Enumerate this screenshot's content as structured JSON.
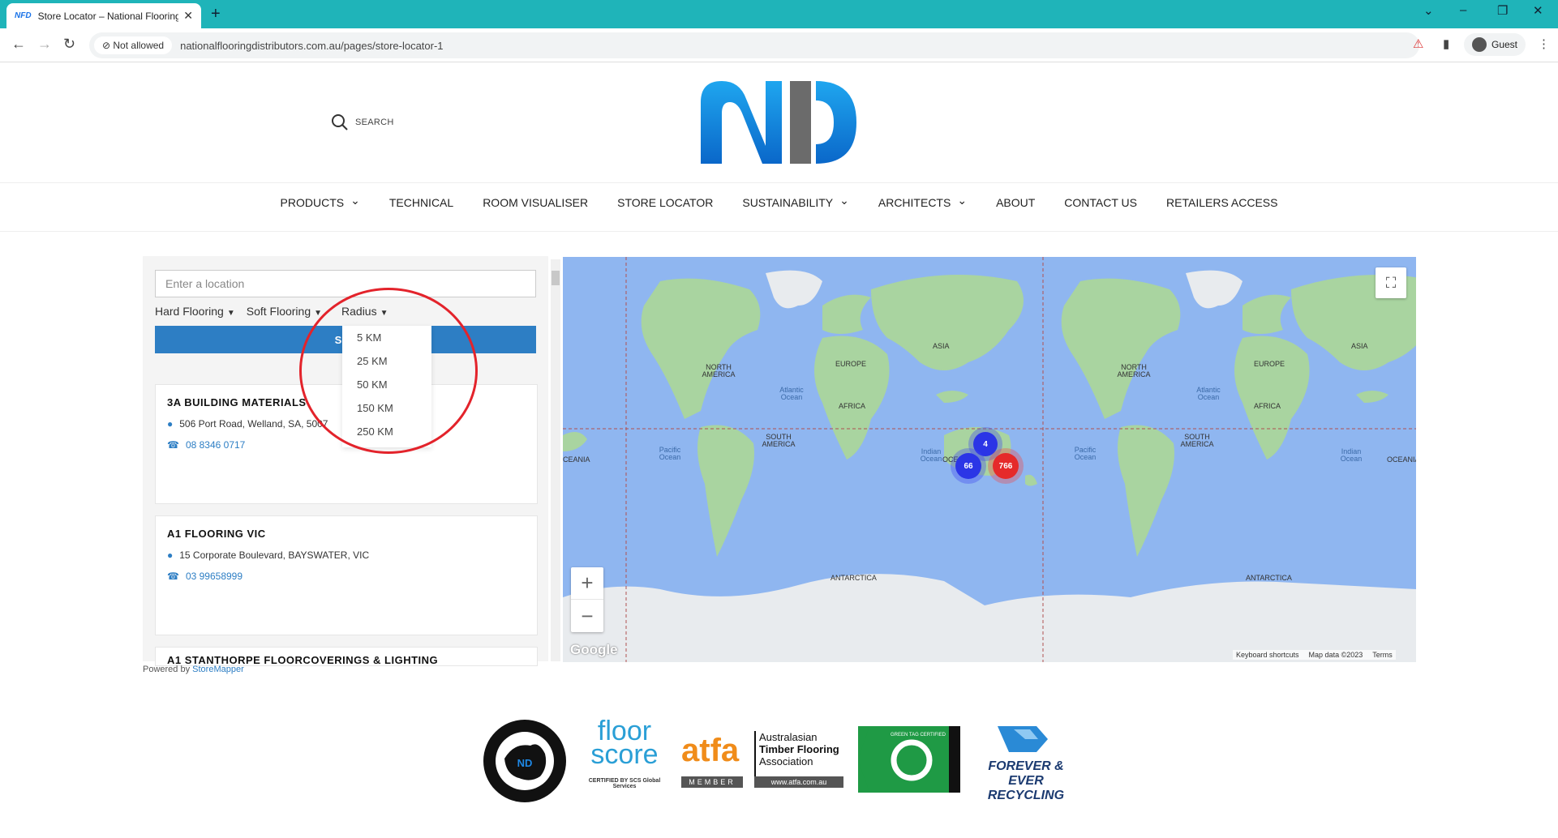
{
  "browser": {
    "tab_title": "Store Locator – National Flooring Distributors",
    "tab_favicon": "NFD",
    "security": "Not allowed",
    "url": "nationalflooringdistributors.com.au/pages/store-locator-1",
    "profile": "Guest"
  },
  "header": {
    "search_label": "SEARCH",
    "logo_text": "NFD",
    "nav": [
      {
        "label": "PRODUCTS",
        "dropdown": true
      },
      {
        "label": "TECHNICAL",
        "dropdown": false
      },
      {
        "label": "ROOM VISUALISER",
        "dropdown": false
      },
      {
        "label": "STORE LOCATOR",
        "dropdown": false
      },
      {
        "label": "SUSTAINABILITY",
        "dropdown": true
      },
      {
        "label": "ARCHITECTS",
        "dropdown": true
      },
      {
        "label": "ABOUT",
        "dropdown": false
      },
      {
        "label": "CONTACT US",
        "dropdown": false
      },
      {
        "label": "RETAILERS ACCESS",
        "dropdown": false
      }
    ]
  },
  "locator": {
    "location_placeholder": "Enter a location",
    "filters": [
      "Hard Flooring",
      "Soft Flooring",
      "Radius"
    ],
    "search_button": "SEA",
    "radius_options": [
      "5 KM",
      "25 KM",
      "50 KM",
      "150 KM",
      "250 KM"
    ],
    "stores": [
      {
        "name": "3A BUILDING MATERIALS",
        "address": "506 Port Road, Welland, SA, 5007",
        "phone": "08 8346 0717"
      },
      {
        "name": "A1 FLOORING VIC",
        "address": "15 Corporate Boulevard, BAYSWATER, VIC",
        "phone": "03 99658999"
      },
      {
        "name": "A1 STANTHORPE FLOORCOVERINGS & LIGHTING",
        "address": "",
        "phone": ""
      }
    ],
    "powered_by": "Powered by",
    "powered_link": "StoreMapper"
  },
  "map": {
    "continents": [
      "NORTH AMERICA",
      "EUROPE",
      "ASIA",
      "AFRICA",
      "SOUTH AMERICA",
      "OCEANIA",
      "ANTARCTICA",
      "NORTH AMERICA",
      "EUROPE",
      "ASIA",
      "AFRICA",
      "SOUTH AMERICA",
      "ANTARCTICA",
      "OCEANIA",
      "CEANIA"
    ],
    "oceans": [
      "Atlantic Ocean",
      "Pacific Ocean",
      "Indian Ocean",
      "Atlantic Ocean",
      "Pacific Ocean",
      "Indian Ocean"
    ],
    "clusters": [
      {
        "count": "4",
        "color": "#2b35e6"
      },
      {
        "count": "66",
        "color": "#2b35e6"
      },
      {
        "count": "766",
        "color": "#e52a2a"
      }
    ],
    "zoom_in": "+",
    "zoom_out": "−",
    "google": "Google",
    "attribution": [
      "Keyboard shortcuts",
      "Map data ©2023",
      "Terms"
    ],
    "colors": {
      "water": "#8fb6f0",
      "land": "#a9d4a0",
      "ice": "#e8ebee"
    }
  },
  "badges": {
    "australian": "AUSTRALIAN OWNED AND OPERATED",
    "floorscore_top": "floor",
    "floorscore_bottom": "score",
    "floorscore_cert": "CERTIFIED BY SCS Global Services",
    "atfa": "atfa",
    "atfa_member": "MEMBER",
    "atfa_name": [
      "Australasian",
      "Timber Flooring",
      "Association"
    ],
    "atfa_url": "www.atfa.com.au",
    "greentag": "GREEN TAG CERTIFIED",
    "forever_line1": "FOREVER & EVER",
    "forever_line2": "RECYCLING"
  }
}
